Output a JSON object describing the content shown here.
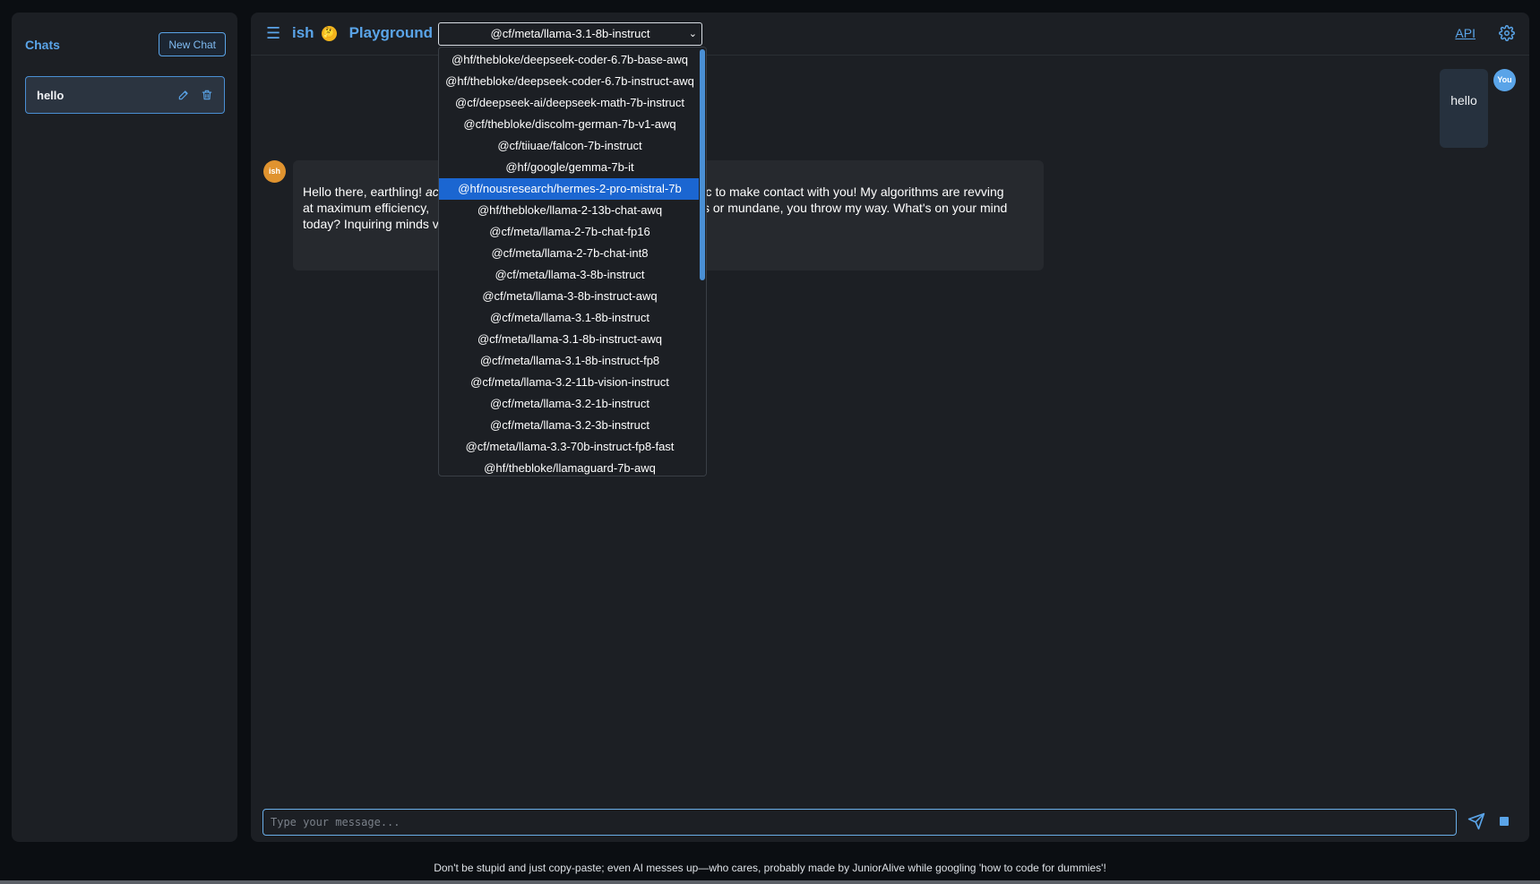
{
  "sidebar": {
    "title": "Chats",
    "new_chat_label": "New Chat",
    "chats": [
      {
        "label": "hello",
        "edit_icon": "pencil-icon",
        "delete_icon": "trash-icon"
      }
    ]
  },
  "header": {
    "menu_icon": "hamburger-icon",
    "brand": "ish",
    "brand_emoji": "🤔",
    "playground_label": "Playground",
    "selected_model": "@cf/meta/llama-3.1-8b-instruct",
    "api_label": "API",
    "settings_icon": "gear-icon"
  },
  "dropdown": {
    "options": [
      "@hf/thebloke/deepseek-coder-6.7b-base-awq",
      "@hf/thebloke/deepseek-coder-6.7b-instruct-awq",
      "@cf/deepseek-ai/deepseek-math-7b-instruct",
      "@cf/thebloke/discolm-german-7b-v1-awq",
      "@cf/tiiuae/falcon-7b-instruct",
      "@hf/google/gemma-7b-it",
      "@hf/nousresearch/hermes-2-pro-mistral-7b",
      "@hf/thebloke/llama-2-13b-chat-awq",
      "@cf/meta/llama-2-7b-chat-fp16",
      "@cf/meta/llama-2-7b-chat-int8",
      "@cf/meta/llama-3-8b-instruct",
      "@cf/meta/llama-3-8b-instruct-awq",
      "@cf/meta/llama-3.1-8b-instruct",
      "@cf/meta/llama-3.1-8b-instruct-awq",
      "@cf/meta/llama-3.1-8b-instruct-fp8",
      "@cf/meta/llama-3.2-11b-vision-instruct",
      "@cf/meta/llama-3.2-1b-instruct",
      "@cf/meta/llama-3.2-3b-instruct",
      "@cf/meta/llama-3.3-70b-instruct-fp8-fast",
      "@hf/thebloke/llamaguard-7b-awq"
    ],
    "highlighted_index": 6
  },
  "messages": {
    "user": {
      "avatar": "You",
      "text": "hello"
    },
    "bot": {
      "avatar": "ish",
      "line1_start": "Hello there, earthling! ",
      "line1_italic": "ac",
      "line1_end": "astic to make contact with you! My algorithms are revving",
      "line2_start": "at maximum efficiency, ",
      "line2_end": "s or mundane, you throw my way. What's on your mind",
      "line3_start": "today? Inquiring minds v"
    }
  },
  "composer": {
    "placeholder": "Type your message...",
    "send_icon": "send-icon",
    "stop_icon": "stop-icon"
  },
  "footer": {
    "text": "Don't be stupid and just copy-paste; even AI messes up—who cares, probably made by JuniorAlive while googling 'how to code for dummies'!"
  }
}
